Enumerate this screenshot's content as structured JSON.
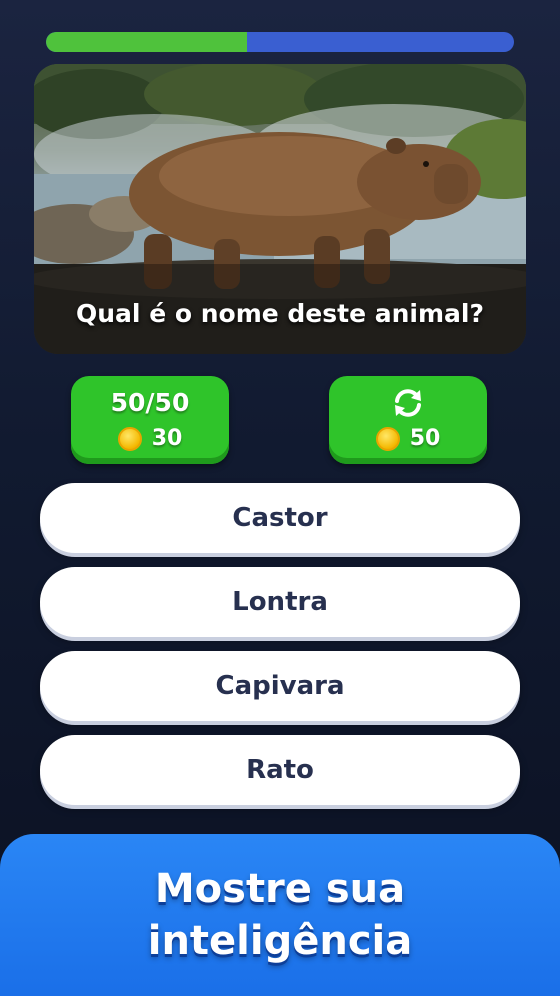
{
  "progress": {
    "value": 0.43
  },
  "question": {
    "text": "Qual é o nome deste animal?"
  },
  "powerups": [
    {
      "label": "50/50",
      "cost": "30",
      "icon": "fifty-fifty"
    },
    {
      "label": "",
      "cost": "50",
      "icon": "refresh-icon"
    }
  ],
  "answers": [
    {
      "label": "Castor"
    },
    {
      "label": "Lontra"
    },
    {
      "label": "Capivara"
    },
    {
      "label": "Rato"
    }
  ],
  "banner": {
    "line1": "Mostre sua",
    "line2": "inteligência"
  },
  "colors": {
    "progress_done": "#4fc23c",
    "progress_remaining": "#3a5fd1",
    "powerup_green": "#2fc42a",
    "answer_text": "#27304f",
    "banner_blue": "#1a6fe8"
  }
}
